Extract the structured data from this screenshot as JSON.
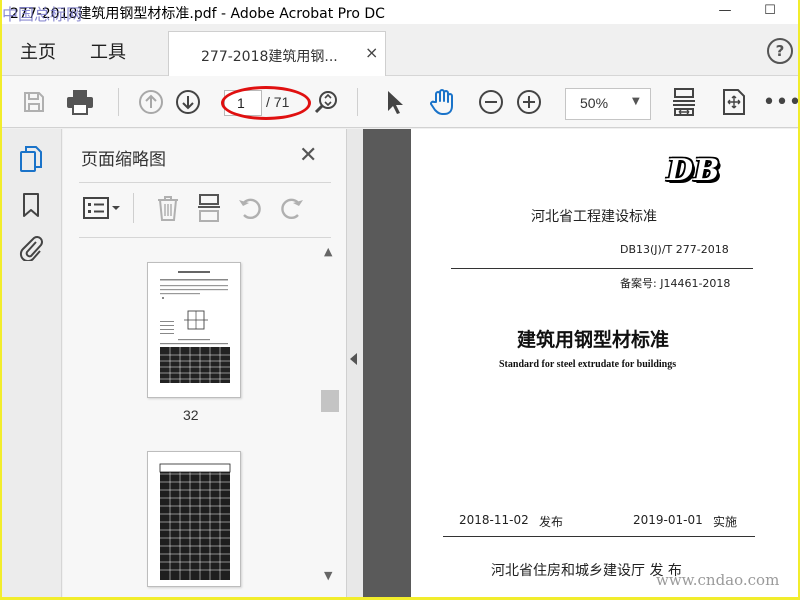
{
  "window": {
    "title": "277-2018建筑用钢型材标准.pdf - Adobe Acrobat Pro DC",
    "minimize_glyph": "—",
    "maximize_glyph": "☐"
  },
  "menu": {
    "home_label": "主页",
    "tools_label": "工具",
    "doc_tab_label": "277-2018建筑用钢...",
    "doc_tab_close": "×",
    "help_glyph": "?"
  },
  "toolbar": {
    "current_page": "1",
    "page_total": "/ 71",
    "zoom_value": "50%",
    "zoom_caret": "▼",
    "icons": [
      "save-icon",
      "print-icon",
      "page-up-icon",
      "page-down-icon",
      "find-zoom-icon",
      "select-arrow-icon",
      "hand-tool-icon",
      "zoom-out-icon",
      "zoom-in-icon",
      "fit-page-icon",
      "full-screen-icon",
      "more-options-icon"
    ],
    "highlight_color": "#e01010"
  },
  "left_rail": {
    "icons": [
      "page-thumbnails-icon",
      "bookmark-icon",
      "attachment-icon"
    ],
    "accent": "#1a73c9"
  },
  "thumbnail_panel": {
    "title": "页面缩略图",
    "close_glyph": "✕",
    "tools": [
      "thumbnail-options-icon",
      "delete-page-icon",
      "extract-page-icon",
      "rotate-left-icon",
      "rotate-right-icon"
    ],
    "thumbnail_label": "32",
    "scroll_up": "▲",
    "scroll_down": "▼"
  },
  "document_page": {
    "db_mark": "DB",
    "organization": "河北省工程建设标准",
    "standard_code": "DB13(J)/T 277-2018",
    "record_number": "备案号: J14461-2018",
    "title_zh": "建筑用钢型材标准",
    "title_en": "Standard for steel extrudate for buildings",
    "issue_date": "2018-11-02",
    "issue_label": "发布",
    "implementation_date": "2019-01-01",
    "implementation_label": "实施",
    "issuer": "河北省住房和城乡建设厅  发  布"
  },
  "watermarks": {
    "top": "中国总标网",
    "bottom": "www.cndao.com"
  },
  "colors": {
    "frame": "#f2ed2c",
    "doc_background": "#5a5a5a",
    "hand_tool": "#1a73c9"
  }
}
